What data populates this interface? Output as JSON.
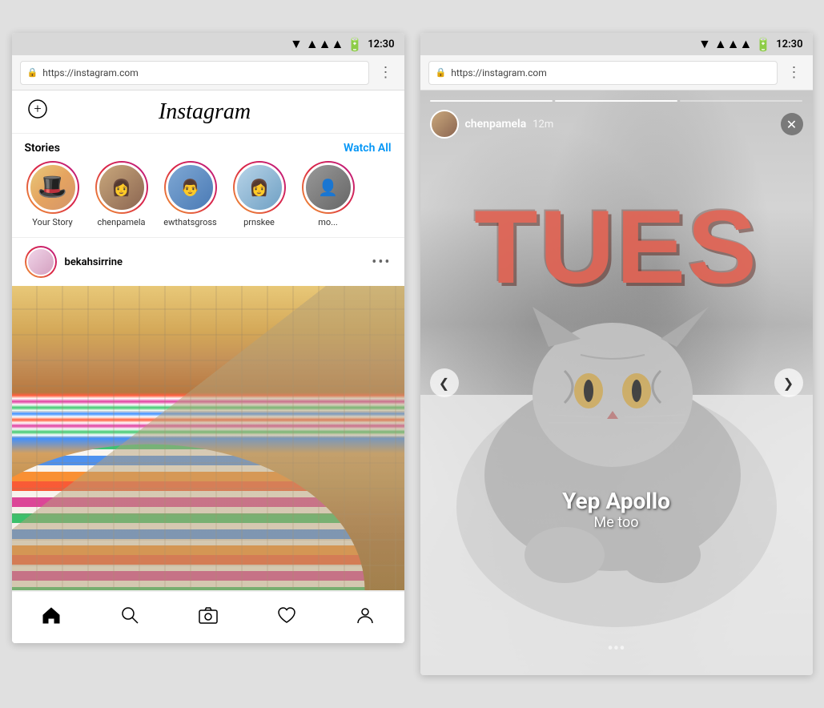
{
  "phone1": {
    "statusBar": {
      "time": "12:30"
    },
    "addressBar": {
      "url": "https://instagram.com",
      "moreLabel": "⋮"
    },
    "header": {
      "addButton": "+",
      "logo": "Instagram",
      "logoAlt": "Instagram"
    },
    "stories": {
      "title": "Stories",
      "watchAll": "Watch All",
      "items": [
        {
          "name": "Your Story",
          "type": "your-story"
        },
        {
          "name": "chenpamela",
          "type": "chenpamela"
        },
        {
          "name": "ewthatsgross",
          "type": "ewt"
        },
        {
          "name": "prnskee",
          "type": "prnskee"
        },
        {
          "name": "mo...",
          "type": "more"
        }
      ]
    },
    "post": {
      "username": "bekahsirrine",
      "moreBtn": "•••"
    },
    "bottomNav": {
      "home": "🏠",
      "search": "🔍",
      "camera": "📷",
      "heart": "♡",
      "profile": "👤"
    }
  },
  "phone2": {
    "statusBar": {
      "time": "12:30"
    },
    "addressBar": {
      "url": "https://instagram.com",
      "moreLabel": "⋮"
    },
    "story": {
      "username": "chenpamela",
      "time": "12m",
      "closeBtn": "✕",
      "bigText": "TUES",
      "captionMain": "Yep Apollo",
      "captionSub": "Me too",
      "navLeft": "❮",
      "navRight": "❯"
    }
  }
}
